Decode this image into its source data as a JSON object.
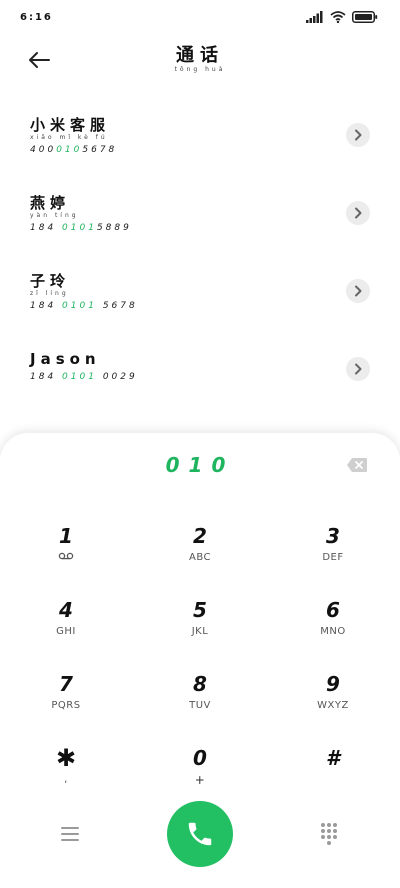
{
  "status_bar": {
    "time": "6:16",
    "signal_icon": "signal-bars-icon",
    "wifi_icon": "wifi-icon",
    "battery_icon": "battery-icon"
  },
  "header": {
    "title": "通话",
    "title_pinyin": "tōng huà",
    "back_icon": "arrow-left-icon"
  },
  "contacts": [
    {
      "name": "小米客服",
      "pinyin": "xiǎo mǐ kè fú",
      "number_pre": "400",
      "number_hl": "010",
      "number_post": "5678"
    },
    {
      "name": "燕婷",
      "pinyin": "yàn tíng",
      "number_pre": "184 ",
      "number_hl": "0101",
      "number_post": "5889"
    },
    {
      "name": "子玲",
      "pinyin": "zǐ líng",
      "number_pre": "184 ",
      "number_hl": "0101",
      "number_post": " 5678"
    },
    {
      "name": "Jason",
      "pinyin": "",
      "number_pre": "184 ",
      "number_hl": "0101",
      "number_post": " 0029"
    }
  ],
  "dialpad": {
    "dialed": "010",
    "backspace_icon": "backspace-icon",
    "keys": [
      {
        "digit": "1",
        "sub": "voicemail"
      },
      {
        "digit": "2",
        "sub": "ABC"
      },
      {
        "digit": "3",
        "sub": "DEF"
      },
      {
        "digit": "4",
        "sub": "GHI"
      },
      {
        "digit": "5",
        "sub": "JKL"
      },
      {
        "digit": "6",
        "sub": "MNO"
      },
      {
        "digit": "7",
        "sub": "PQRS"
      },
      {
        "digit": "8",
        "sub": "TUV"
      },
      {
        "digit": "9",
        "sub": "WXYZ"
      },
      {
        "digit": "✱",
        "sub": ","
      },
      {
        "digit": "0",
        "sub": "+"
      },
      {
        "digit": "#",
        "sub": ""
      }
    ]
  },
  "bottom_bar": {
    "menu_icon": "menu-icon",
    "call_icon": "phone-icon",
    "dialpad_toggle_icon": "dialpad-grid-icon"
  },
  "colors": {
    "accent": "#1fb55f",
    "call_button": "#22c063"
  }
}
